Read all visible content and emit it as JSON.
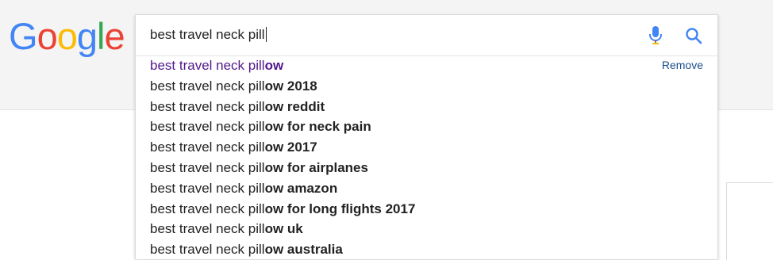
{
  "logo": {
    "letters": [
      "G",
      "o",
      "o",
      "g",
      "l",
      "e"
    ],
    "colors": [
      "#4285f4",
      "#ea4335",
      "#fbbc05",
      "#4285f4",
      "#34a853",
      "#ea4335"
    ]
  },
  "search": {
    "query": "best travel neck pill",
    "mic_icon": "microphone-icon",
    "search_icon": "magnifier-icon"
  },
  "suggestions": [
    {
      "prefix": "best travel neck pill",
      "completion": "ow",
      "history": true,
      "remove_label": "Remove"
    },
    {
      "prefix": "best travel neck pill",
      "completion": "ow 2018"
    },
    {
      "prefix": "best travel neck pill",
      "completion": "ow reddit"
    },
    {
      "prefix": "best travel neck pill",
      "completion": "ow for neck pain"
    },
    {
      "prefix": "best travel neck pill",
      "completion": "ow 2017"
    },
    {
      "prefix": "best travel neck pill",
      "completion": "ow for airplanes"
    },
    {
      "prefix": "best travel neck pill",
      "completion": "ow amazon"
    },
    {
      "prefix": "best travel neck pill",
      "completion": "ow for long flights 2017"
    },
    {
      "prefix": "best travel neck pill",
      "completion": "ow uk"
    },
    {
      "prefix": "best travel neck pill",
      "completion": "ow australia"
    }
  ],
  "colors": {
    "history_text": "#52188c",
    "link": "#1a4e8a",
    "mic_blue": "#4285f4",
    "mic_red": "#ea4335"
  }
}
